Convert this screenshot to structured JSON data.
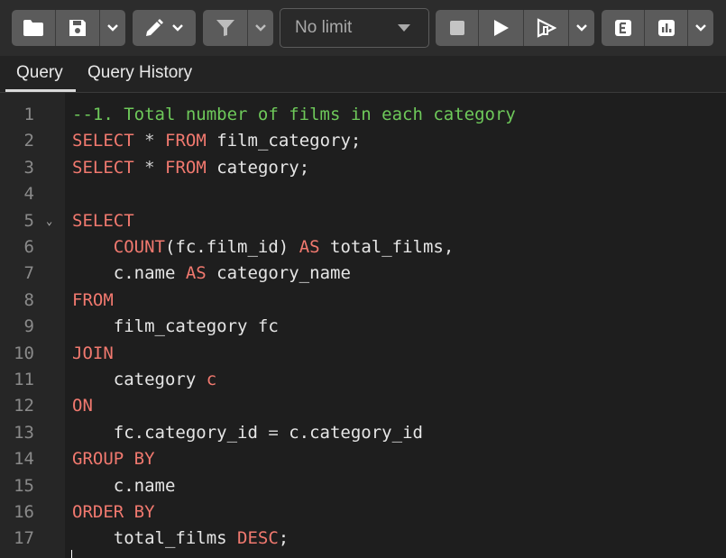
{
  "toolbar": {
    "limit_select": {
      "value": "No limit"
    },
    "icons": [
      "folder-icon",
      "save-icon",
      "chevron-down-icon",
      "edit-pencil-icon",
      "filter-icon",
      "stop-icon",
      "play-icon",
      "execute-script-icon",
      "explain-icon",
      "analyze-chart-icon"
    ]
  },
  "tabs": [
    {
      "label": "Query",
      "active": true
    },
    {
      "label": "Query History",
      "active": false
    }
  ],
  "editor": {
    "lines": [
      {
        "n": "1",
        "tokens": [
          {
            "t": "--1. Total number of films in each category",
            "c": "cm"
          }
        ]
      },
      {
        "n": "2",
        "tokens": [
          {
            "t": "SELECT",
            "c": "kw"
          },
          {
            "t": " ",
            "c": ""
          },
          {
            "t": "*",
            "c": "op"
          },
          {
            "t": " ",
            "c": ""
          },
          {
            "t": "FROM",
            "c": "kw"
          },
          {
            "t": " film_category;",
            "c": ""
          }
        ]
      },
      {
        "n": "3",
        "tokens": [
          {
            "t": "SELECT",
            "c": "kw"
          },
          {
            "t": " ",
            "c": ""
          },
          {
            "t": "*",
            "c": "op"
          },
          {
            "t": " ",
            "c": ""
          },
          {
            "t": "FROM",
            "c": "kw"
          },
          {
            "t": " category;",
            "c": ""
          }
        ]
      },
      {
        "n": "4",
        "tokens": []
      },
      {
        "n": "5",
        "fold": true,
        "tokens": [
          {
            "t": "SELECT",
            "c": "kw"
          }
        ]
      },
      {
        "n": "6",
        "tokens": [
          {
            "t": "    ",
            "c": ""
          },
          {
            "t": "COUNT",
            "c": "kw"
          },
          {
            "t": "(fc.film_id) ",
            "c": ""
          },
          {
            "t": "AS",
            "c": "kw"
          },
          {
            "t": " total_films,",
            "c": ""
          }
        ]
      },
      {
        "n": "7",
        "tokens": [
          {
            "t": "    c.name ",
            "c": ""
          },
          {
            "t": "AS",
            "c": "kw"
          },
          {
            "t": " category_name",
            "c": ""
          }
        ]
      },
      {
        "n": "8",
        "tokens": [
          {
            "t": "FROM",
            "c": "kw"
          }
        ]
      },
      {
        "n": "9",
        "tokens": [
          {
            "t": "    film_category fc",
            "c": ""
          }
        ]
      },
      {
        "n": "10",
        "tokens": [
          {
            "t": "JOIN",
            "c": "kw"
          }
        ]
      },
      {
        "n": "11",
        "tokens": [
          {
            "t": "    category ",
            "c": ""
          },
          {
            "t": "c",
            "c": "kw"
          }
        ]
      },
      {
        "n": "12",
        "tokens": [
          {
            "t": "ON",
            "c": "kw"
          }
        ]
      },
      {
        "n": "13",
        "tokens": [
          {
            "t": "    fc.category_id ",
            "c": ""
          },
          {
            "t": "=",
            "c": "op"
          },
          {
            "t": " c.category_id",
            "c": ""
          }
        ]
      },
      {
        "n": "14",
        "tokens": [
          {
            "t": "GROUP BY",
            "c": "kw"
          }
        ]
      },
      {
        "n": "15",
        "tokens": [
          {
            "t": "    c.name",
            "c": ""
          }
        ]
      },
      {
        "n": "16",
        "tokens": [
          {
            "t": "ORDER BY",
            "c": "kw"
          }
        ]
      },
      {
        "n": "17",
        "tokens": [
          {
            "t": "    total_films ",
            "c": ""
          },
          {
            "t": "DESC",
            "c": "kw"
          },
          {
            "t": ";",
            "c": ""
          }
        ]
      }
    ]
  },
  "colors": {
    "keyword": "#f1796f",
    "comment": "#6ec95a",
    "button_bg": "#5b5b5b",
    "toolbar_bg": "#2c2c2c"
  }
}
